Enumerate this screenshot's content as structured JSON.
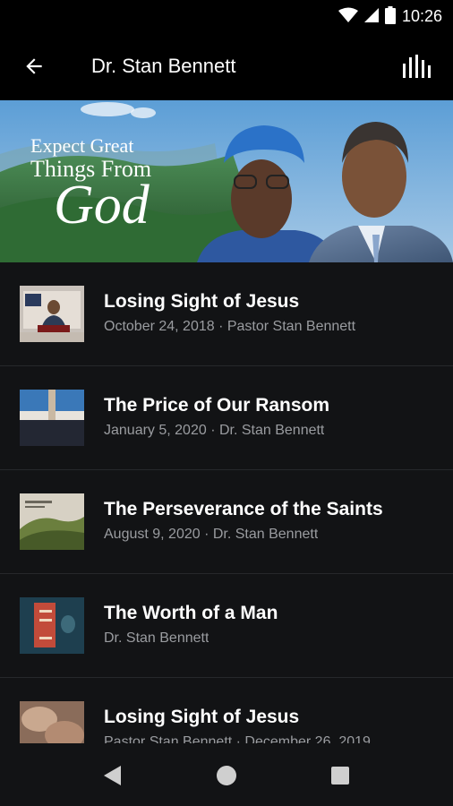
{
  "status_bar": {
    "time": "10:26"
  },
  "app_bar": {
    "title": "Dr. Stan Bennett"
  },
  "banner": {
    "line1": "Expect Great",
    "line2": "Things From",
    "line3": "God"
  },
  "items": [
    {
      "title": "Losing Sight of Jesus",
      "subtitle": "October 24, 2018 · Pastor Stan Bennett"
    },
    {
      "title": "The Price of Our Ransom",
      "subtitle": "January 5, 2020 · Dr. Stan Bennett"
    },
    {
      "title": "The Perseverance of the Saints",
      "subtitle": "August 9, 2020 · Dr. Stan Bennett"
    },
    {
      "title": "The Worth of a Man",
      "subtitle": "Dr. Stan Bennett"
    },
    {
      "title": "Losing Sight of Jesus",
      "subtitle": "Pastor Stan Bennett · December 26, 2019"
    }
  ],
  "colors": {
    "background": "#121315",
    "bar": "#000000",
    "subtitle": "#9a9ca0",
    "divider": "#26282b"
  }
}
